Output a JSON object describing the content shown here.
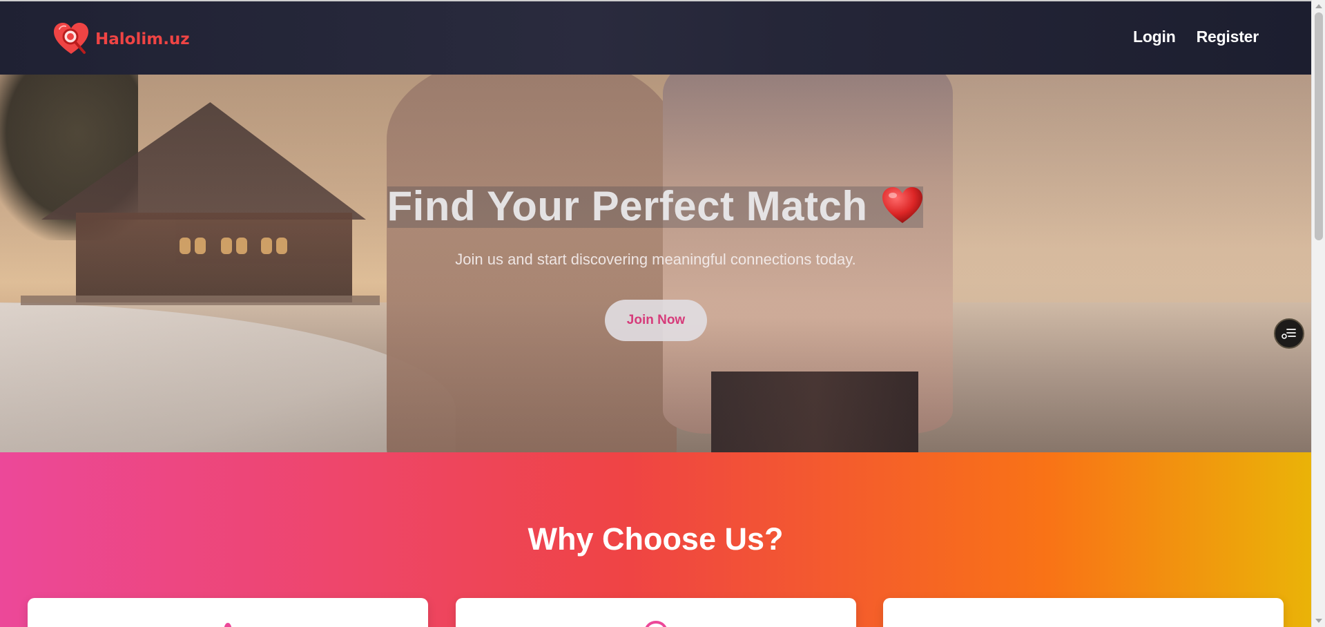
{
  "header": {
    "brand_name": "Halolim.uz",
    "logo_icon": "heart-magnifier-icon",
    "nav": {
      "login": "Login",
      "register": "Register"
    }
  },
  "hero": {
    "title": "Find Your Perfect Match",
    "title_icon": "red-heart-icon",
    "subtitle": "Join us and start discovering meaningful connections today.",
    "cta_label": "Join Now",
    "floating_button_icon": "list-settings-icon"
  },
  "why_section": {
    "title": "Why Choose Us?",
    "cards": [
      {
        "icon": "heart-icon"
      },
      {
        "icon": "circle-heart-icon"
      },
      {
        "icon": "blank"
      }
    ]
  },
  "colors": {
    "brand_red": "#ef4444",
    "cta_text": "#d63b7a",
    "gradient": [
      "#ec4899",
      "#ef4444",
      "#f97316",
      "#eab308"
    ],
    "navbar": "#1f2133"
  }
}
